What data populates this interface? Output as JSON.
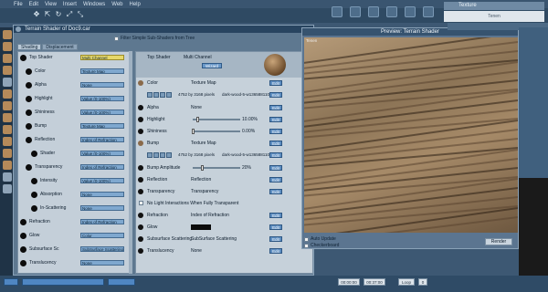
{
  "menu": [
    "File",
    "Edit",
    "View",
    "Insert",
    "Windows",
    "Web",
    "Help"
  ],
  "texture_tab": "Texture",
  "tenen_bar": "Tenen",
  "editor": {
    "title": "Terrain Shader of Doc9.car",
    "filter_label": "Filter Simple Sub-Shaders from Tree",
    "tabs": [
      "Shading",
      "Displacement"
    ]
  },
  "tree": [
    {
      "label": "Top Shader",
      "value": "Multi Channel",
      "top": true
    },
    {
      "label": "Color",
      "value": "Texture Map"
    },
    {
      "label": "Alpha",
      "value": "None"
    },
    {
      "label": "Highlight",
      "value": "Value (0-100%)"
    },
    {
      "label": "Shininess",
      "value": "Value (0-100%)"
    },
    {
      "label": "Bump",
      "value": "Texture Map"
    },
    {
      "label": "Reflection",
      "value": "Index of Refraction"
    },
    {
      "label": "Shader",
      "value": "Value (0-100%)"
    },
    {
      "label": "Transparency",
      "value": "Index of Refraction"
    },
    {
      "label": "Intensity",
      "value": "Value (0-100%)"
    },
    {
      "label": "Absorption",
      "value": "None"
    },
    {
      "label": "In-Scattering",
      "value": "None"
    },
    {
      "label": "Refraction",
      "value": "Index of Refraction"
    },
    {
      "label": "Glow",
      "value": "Color"
    },
    {
      "label": "Subsurface Sc",
      "value": "SubSurface Scattering"
    },
    {
      "label": "Translucency",
      "value": "None"
    }
  ],
  "props": {
    "header": {
      "shader": "Top Shader",
      "channel": "Multi Channel",
      "wizard": "Wizard"
    },
    "rows": [
      {
        "name": "Color",
        "value": "Texture Map",
        "kind": "tex"
      },
      {
        "name": "",
        "info": "4752 by 3168 pixels",
        "info2": "dark-wood-5-w1365881102...",
        "kind": "icons"
      },
      {
        "name": "Alpha",
        "value": "None",
        "kind": "plain"
      },
      {
        "name": "Highlight",
        "pct": "10.00%",
        "kind": "slider",
        "level": 0.1
      },
      {
        "name": "Shininess",
        "pct": "0.00%",
        "kind": "slider",
        "level": 0.0
      },
      {
        "name": "Bump",
        "value": "Texture Map",
        "kind": "tex"
      },
      {
        "name": "",
        "info": "4752 by 3168 pixels",
        "info2": "dark-wood-5-w1365881102...",
        "kind": "icons"
      },
      {
        "name": "Bump Amplitude",
        "pct": "20%",
        "kind": "slider",
        "level": 0.2
      },
      {
        "name": "Reflection",
        "value": "Reflection",
        "kind": "plain"
      },
      {
        "name": "Transparency",
        "value": "Transparency",
        "kind": "plain"
      },
      {
        "name": "No Light Interactions When Fully Transparent",
        "kind": "check"
      },
      {
        "name": "Refraction",
        "value": "Index of Refraction",
        "kind": "plain"
      },
      {
        "name": "Glow",
        "kind": "black"
      },
      {
        "name": "Subsurface Scattering",
        "value": "SubSurface Scattering",
        "kind": "plain"
      },
      {
        "name": "Translucency",
        "value": "None",
        "kind": "plain"
      }
    ],
    "edit_label": "Edit"
  },
  "preview": {
    "title": "Preview: Terrain Shader",
    "tenen": "Tenen",
    "auto_update": "Auto Update",
    "checkerboard": "Checkerboard",
    "render": "Render"
  },
  "bottom": {
    "time_a": "00:00:00",
    "time_b": "00:37:00",
    "loop": "Loop",
    "fps": "0"
  }
}
